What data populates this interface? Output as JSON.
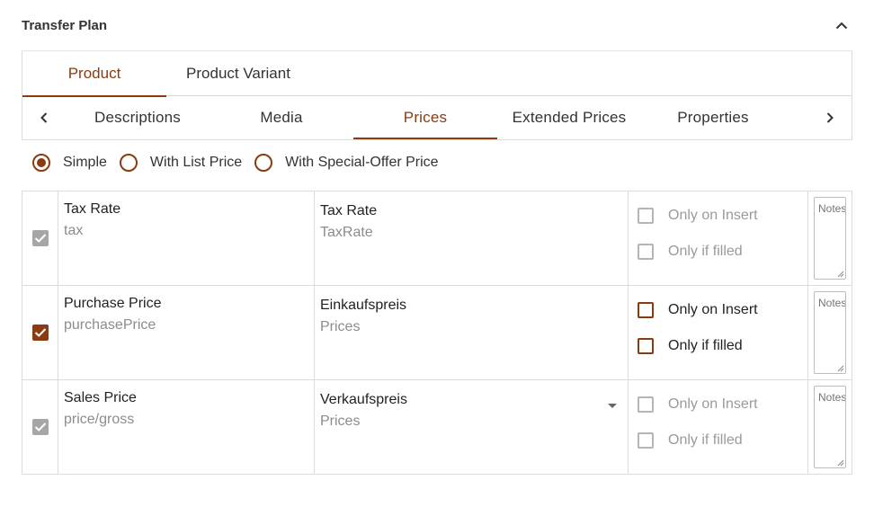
{
  "header": {
    "title": "Transfer Plan"
  },
  "tabs_entity": [
    {
      "label": "Product"
    },
    {
      "label": "Product Variant"
    }
  ],
  "tabs_section": [
    {
      "label": "Descriptions"
    },
    {
      "label": "Media"
    },
    {
      "label": "Prices"
    },
    {
      "label": "Extended Prices"
    },
    {
      "label": "Properties"
    }
  ],
  "price_mode": {
    "options": [
      {
        "label": "Simple"
      },
      {
        "label": "With List Price"
      },
      {
        "label": "With Special-Offer Price"
      }
    ],
    "selected": "Simple"
  },
  "rows": [
    {
      "field_title": "Tax Rate",
      "field_key": "tax",
      "target_title": "Tax Rate",
      "target_sub": "TaxRate",
      "only_insert": "Only on Insert",
      "only_filled": "Only if filled",
      "note_placeholder": "Notes"
    },
    {
      "field_title": "Purchase Price",
      "field_key": "purchasePrice",
      "target_title": "Einkaufspreis",
      "target_sub": "Prices",
      "only_insert": "Only on Insert",
      "only_filled": "Only if filled",
      "note_placeholder": "Notes"
    },
    {
      "field_title": "Sales Price",
      "field_key": "price/gross",
      "target_title": "Verkaufspreis",
      "target_sub": "Prices",
      "only_insert": "Only on Insert",
      "only_filled": "Only if filled",
      "note_placeholder": "Notes"
    }
  ],
  "colors": {
    "brand": "#8a3c10",
    "muted": "#a6a6a6",
    "border": "#dcdcdc"
  }
}
